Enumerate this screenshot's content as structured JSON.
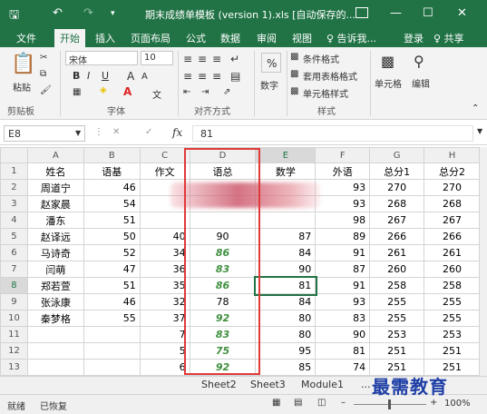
{
  "titlebar": {
    "save_icon": "save-icon",
    "undo_icon": "undo-icon",
    "redo_icon": "redo-icon",
    "title": "期末成绩单模板 (version 1).xls [自动保存的...",
    "ribbon_display_icon": "ribbon-display-icon",
    "min": "—",
    "max": "☐",
    "close": "✕"
  },
  "tabs": [
    "文件",
    "开始",
    "插入",
    "页面布局",
    "公式",
    "数据",
    "审阅",
    "视图"
  ],
  "tell_me": "♀ 告诉我...",
  "login": "登录",
  "share": "♀ 共享",
  "ribbon": {
    "paste": "粘贴",
    "clipboard": "剪贴板",
    "font_name": "宋体",
    "font_size": "10",
    "bold": "B",
    "italic": "I",
    "underline": "U",
    "grow": "A",
    "shrink": "A",
    "font_group": "字体",
    "align_group": "对齐方式",
    "number_pct": "%",
    "number_label": "数字",
    "cond_format": "条件格式",
    "table_format": "套用表格格式",
    "cell_style": "单元格样式",
    "style_group": "样式",
    "cells": "单元格",
    "edit": "编辑",
    "wen": "文"
  },
  "formula": {
    "namebox": "E8",
    "cancel": "✕",
    "enter": "✓",
    "fx": "fx",
    "content": "81"
  },
  "columns": [
    "A",
    "B",
    "C",
    "D",
    "E",
    "F",
    "G",
    "H"
  ],
  "rows": [
    {
      "n": "1",
      "A": "姓名",
      "B": "语基",
      "C": "作文",
      "D": "语总",
      "E": "数学",
      "F": "外语",
      "G": "总分1",
      "H": "总分2",
      "header": true
    },
    {
      "n": "2",
      "A": "周道宁",
      "B": "46",
      "C": "",
      "D": "",
      "E": "",
      "F": "93",
      "G": "270",
      "H": "270"
    },
    {
      "n": "3",
      "A": "赵家晨",
      "B": "54",
      "C": "",
      "D": "",
      "E": "",
      "F": "93",
      "G": "268",
      "H": "268"
    },
    {
      "n": "4",
      "A": "潘东",
      "B": "51",
      "C": "",
      "D": "",
      "E": "",
      "F": "98",
      "G": "267",
      "H": "267"
    },
    {
      "n": "5",
      "A": "赵译远",
      "B": "50",
      "C": "40",
      "D": "90",
      "E": "87",
      "F": "89",
      "G": "266",
      "H": "266"
    },
    {
      "n": "6",
      "A": "马诗奇",
      "B": "52",
      "C": "34",
      "D": "86",
      "E": "84",
      "F": "91",
      "G": "261",
      "H": "261",
      "green": true
    },
    {
      "n": "7",
      "A": "闫萌",
      "B": "47",
      "C": "36",
      "D": "83",
      "E": "90",
      "F": "87",
      "G": "260",
      "H": "260",
      "green": true
    },
    {
      "n": "8",
      "A": "郑若萱",
      "B": "51",
      "C": "35",
      "D": "86",
      "E": "81",
      "F": "91",
      "G": "258",
      "H": "258",
      "green": true
    },
    {
      "n": "9",
      "A": "张泳康",
      "B": "46",
      "C": "32",
      "D": "78",
      "E": "84",
      "F": "93",
      "G": "255",
      "H": "255"
    },
    {
      "n": "10",
      "A": "秦梦格",
      "B": "55",
      "C": "37",
      "D": "92",
      "E": "80",
      "F": "83",
      "G": "255",
      "H": "255",
      "green": true
    },
    {
      "n": "11",
      "A": "",
      "B": "",
      "C": "7",
      "D": "83",
      "E": "80",
      "F": "90",
      "G": "253",
      "H": "253",
      "green": true
    },
    {
      "n": "12",
      "A": "",
      "B": "",
      "C": "5",
      "D": "75",
      "E": "95",
      "F": "81",
      "G": "251",
      "H": "251",
      "green": true
    },
    {
      "n": "13",
      "A": "",
      "B": "",
      "C": "6",
      "D": "92",
      "E": "85",
      "F": "74",
      "G": "251",
      "H": "251",
      "green": true
    }
  ],
  "sheets": [
    "Sheet2",
    "Sheet3",
    "Module1"
  ],
  "sheet_more": "...",
  "status": {
    "ready": "就绪",
    "recovered": "已恢复",
    "zoom": "100%",
    "plus": "+"
  },
  "watermark": "最需教育"
}
